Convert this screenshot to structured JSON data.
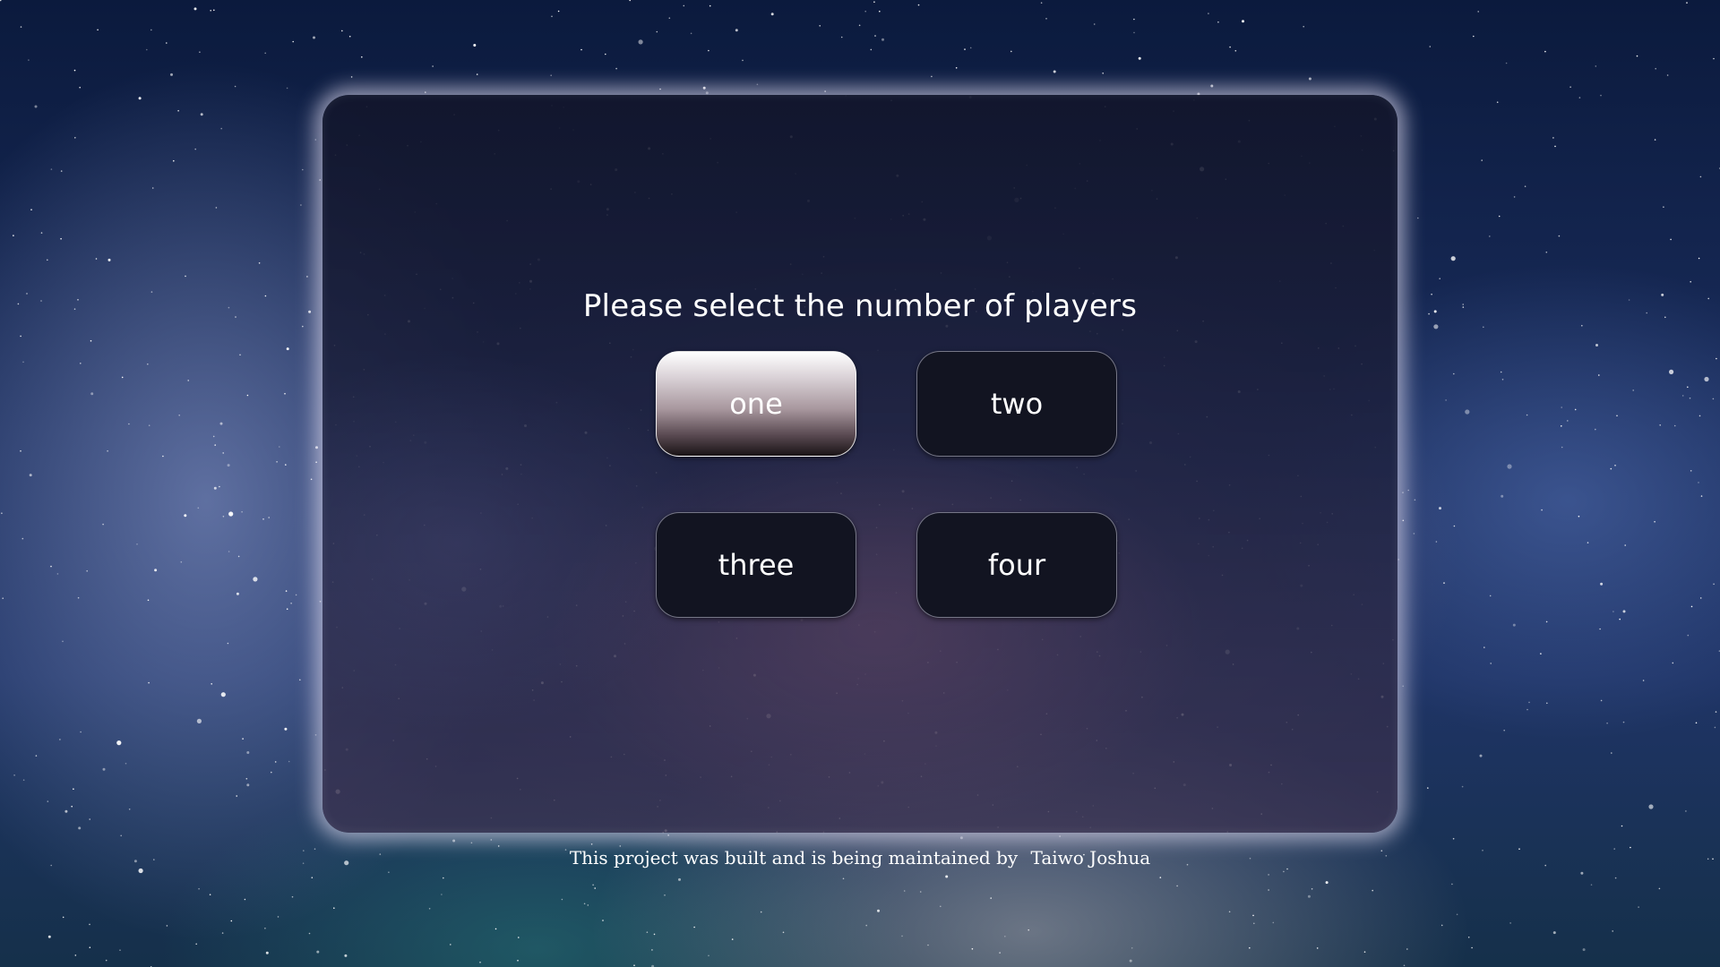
{
  "prompt": {
    "title": "Please select the number of players"
  },
  "player_options": [
    {
      "label": "one",
      "selected": true
    },
    {
      "label": "two",
      "selected": false
    },
    {
      "label": "three",
      "selected": false
    },
    {
      "label": "four",
      "selected": false
    }
  ],
  "footer": {
    "text": "This project was built and is being maintained by",
    "author": "Taiwo Joshua"
  },
  "colors": {
    "panel_glow": "#e1dcf0",
    "button_background": "#121421",
    "selected_button_top": "#ffffff",
    "selected_button_bottom": "#1a1416",
    "text": "#ffffff"
  }
}
